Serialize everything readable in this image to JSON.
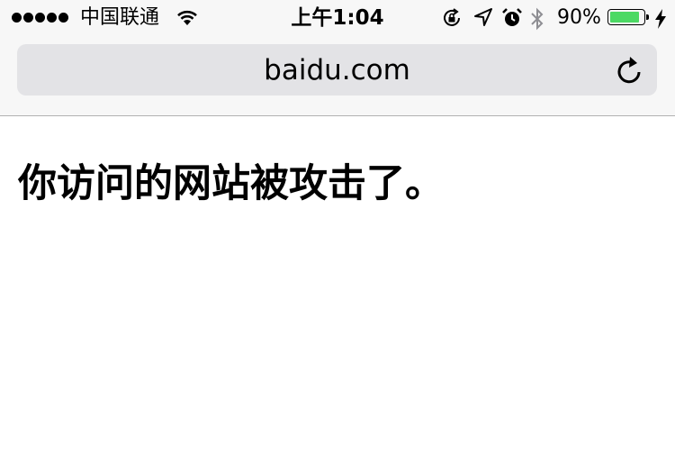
{
  "status_bar": {
    "carrier": "中国联通",
    "time": "上午1:04",
    "battery_percent": "90%",
    "battery_level": 0.9,
    "icons": [
      "signal-dots-icon",
      "wifi-icon",
      "orientation-lock-icon",
      "location-arrow-icon",
      "alarm-icon",
      "bluetooth-icon",
      "battery-icon",
      "charging-bolt-icon"
    ]
  },
  "address_bar": {
    "url": "baidu.com",
    "reload_icon": "reload-icon"
  },
  "page": {
    "message": "你访问的网站被攻击了。"
  }
}
